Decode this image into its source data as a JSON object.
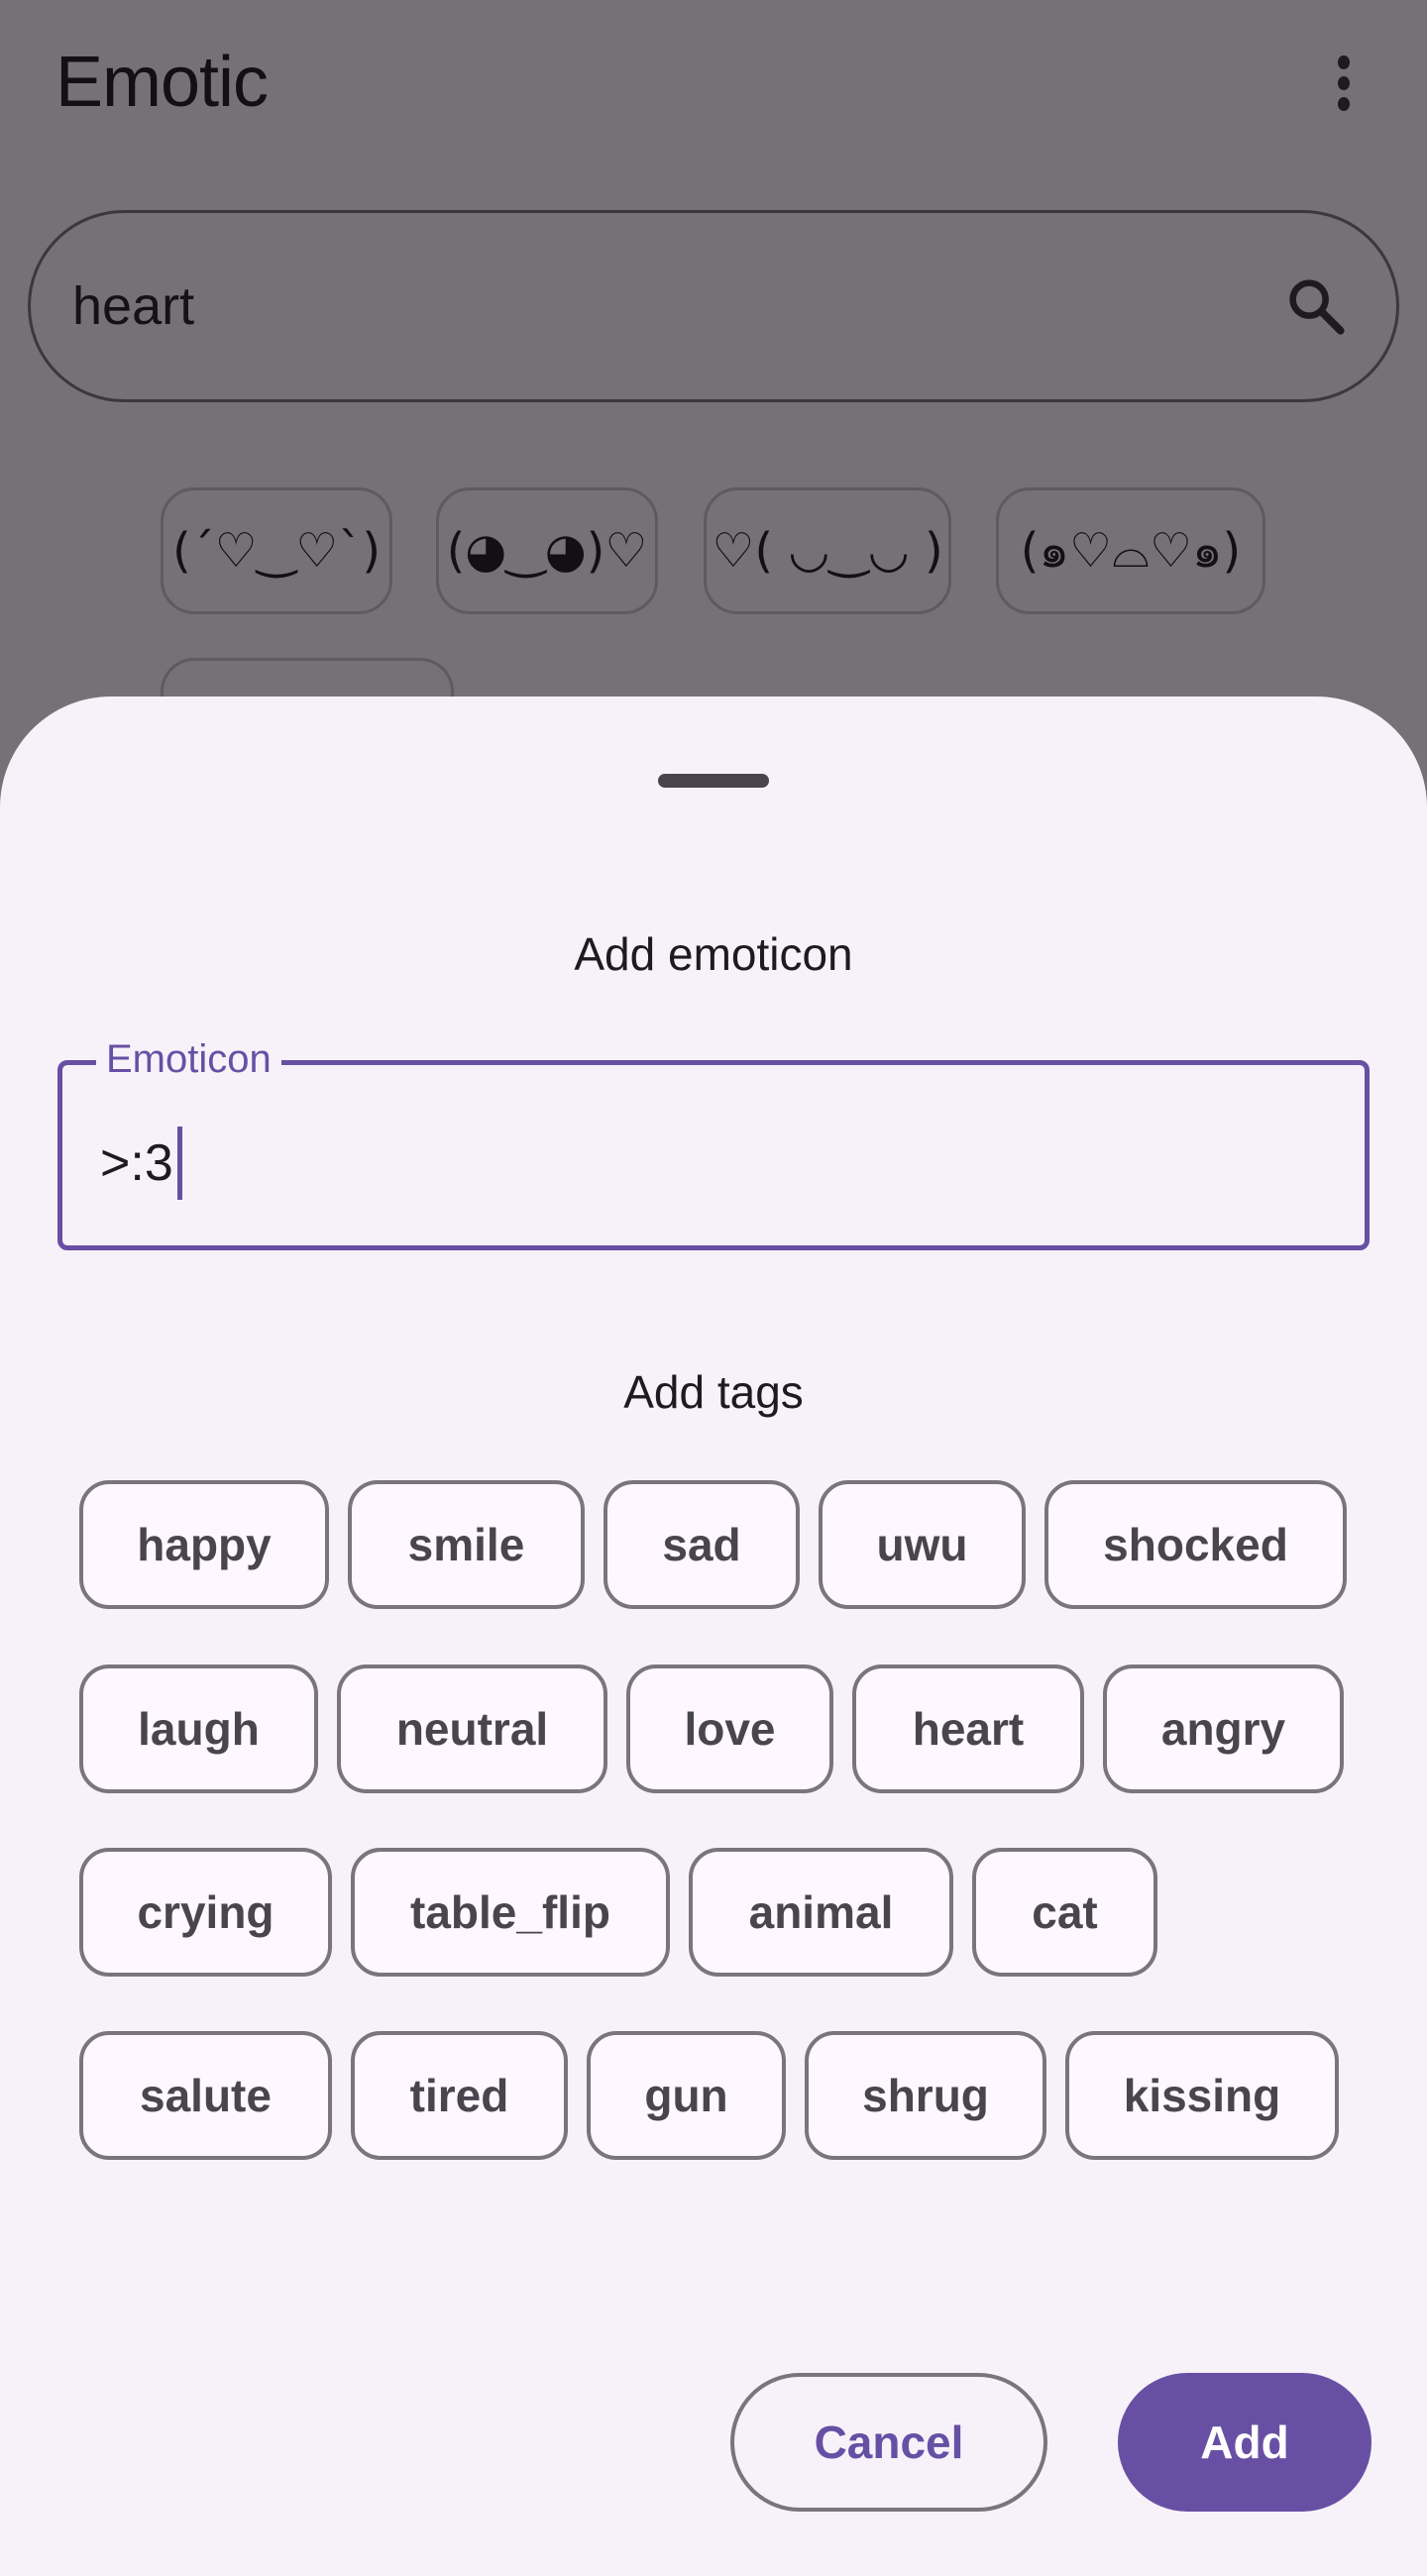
{
  "app": {
    "title": "Emotic",
    "menu_icon": "more-vert-icon"
  },
  "search": {
    "value": "heart",
    "icon": "search-icon"
  },
  "results": [
    "(´♡‿♡`)",
    "(◕‿◕)♡",
    "♡( ◡‿◡ )",
    "(๑♡⌓♡๑)",
    ""
  ],
  "sheet": {
    "title": "Add emoticon",
    "field": {
      "label": "Emoticon",
      "value": ">:3"
    },
    "tags_title": "Add tags",
    "tags": [
      "happy",
      "smile",
      "sad",
      "uwu",
      "shocked",
      "laugh",
      "neutral",
      "love",
      "heart",
      "angry",
      "crying",
      "table_flip",
      "animal",
      "cat",
      "salute",
      "tired",
      "gun",
      "shrug",
      "kissing"
    ],
    "cancel_label": "Cancel",
    "add_label": "Add"
  },
  "colors": {
    "primary": "#6750a4",
    "scrim_background": "#757174",
    "sheet_background": "#f7f2f9",
    "chip_outline": "#79747e",
    "chip_text": "#49454f"
  }
}
